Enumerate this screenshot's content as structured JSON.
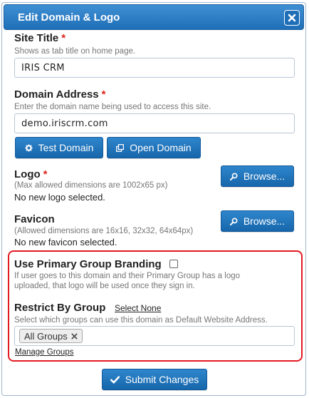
{
  "dialog": {
    "title": "Edit Domain & Logo"
  },
  "site_title": {
    "label": "Site Title",
    "required_mark": "*",
    "hint": "Shows as tab title on home page.",
    "value": "IRIS CRM"
  },
  "domain_address": {
    "label": "Domain Address",
    "required_mark": "*",
    "hint": "Enter the domain name being used to access this site.",
    "value": "demo.iriscrm.com",
    "test_button": "Test Domain",
    "open_button": "Open Domain"
  },
  "logo": {
    "label": "Logo",
    "required_mark": "*",
    "hint": "(Max allowed dimensions are 1002x65 px)",
    "status": "No new logo selected.",
    "browse_button": "Browse..."
  },
  "favicon": {
    "label": "Favicon",
    "hint": "(Allowed dimensions are 16x16, 32x32, 64x64px)",
    "status": "No new favicon selected.",
    "browse_button": "Browse..."
  },
  "branding": {
    "label": "Use Primary Group Branding",
    "checked": false,
    "hint_line1": "If user goes to this domain and their Primary Group has a logo",
    "hint_line2": "uploaded, that logo will be used once they sign in."
  },
  "restrict": {
    "label": "Restrict By Group",
    "select_none": "Select None",
    "hint": "Select which groups can use this domain as Default Website Address.",
    "selected_groups": [
      "All Groups"
    ],
    "manage_link": "Manage Groups"
  },
  "footer": {
    "submit_button": "Submit Changes"
  },
  "colors": {
    "accent": "#1f6fb8",
    "required": "#d9241c",
    "highlight_box": "#e11b22"
  }
}
